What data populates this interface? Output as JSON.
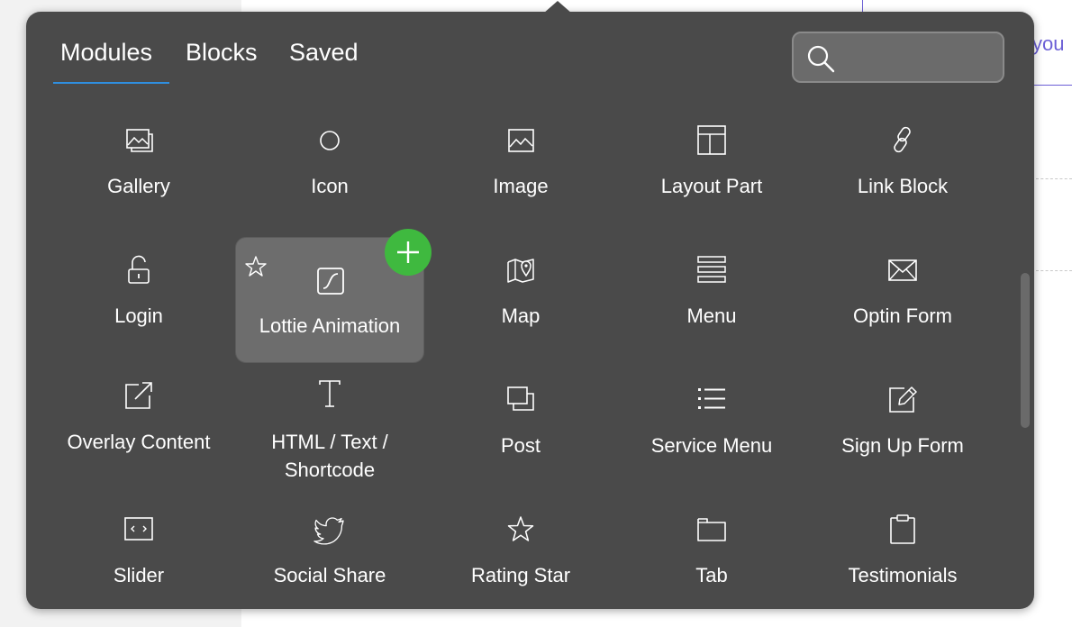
{
  "background": {
    "link_text": "you"
  },
  "tabs": {
    "modules": "Modules",
    "blocks": "Blocks",
    "saved": "Saved",
    "active": "Modules"
  },
  "search": {
    "placeholder": "",
    "value": ""
  },
  "modules": [
    {
      "label": "Gallery",
      "icon": "gallery-icon"
    },
    {
      "label": "Icon",
      "icon": "circle-icon"
    },
    {
      "label": "Image",
      "icon": "image-icon"
    },
    {
      "label": "Layout Part",
      "icon": "layout-part-icon"
    },
    {
      "label": "Link Block",
      "icon": "link-icon"
    },
    {
      "label": "Login",
      "icon": "lock-icon"
    },
    {
      "label": "Lottie Animation",
      "icon": "lottie-icon"
    },
    {
      "label": "Map",
      "icon": "map-icon"
    },
    {
      "label": "Menu",
      "icon": "menu-icon"
    },
    {
      "label": "Optin Form",
      "icon": "envelope-icon"
    },
    {
      "label": "Overlay Content",
      "icon": "external-link-icon"
    },
    {
      "label": "HTML / Text / Shortcode",
      "icon": "text-icon"
    },
    {
      "label": "Post",
      "icon": "post-icon"
    },
    {
      "label": "Service Menu",
      "icon": "list-icon"
    },
    {
      "label": "Sign Up Form",
      "icon": "edit-icon"
    },
    {
      "label": "Slider",
      "icon": "slider-icon"
    },
    {
      "label": "Social Share",
      "icon": "twitter-icon"
    },
    {
      "label": "Rating Star",
      "icon": "star-icon"
    },
    {
      "label": "Tab",
      "icon": "folder-icon"
    },
    {
      "label": "Testimonials",
      "icon": "clipboard-icon"
    }
  ],
  "colors": {
    "panel_bg": "#4a4a4a",
    "hover_bg": "#6d6d6d",
    "add_button": "#3fb93f",
    "tab_underline": "#2f8fe0",
    "link_accent": "#6b5fd6"
  }
}
